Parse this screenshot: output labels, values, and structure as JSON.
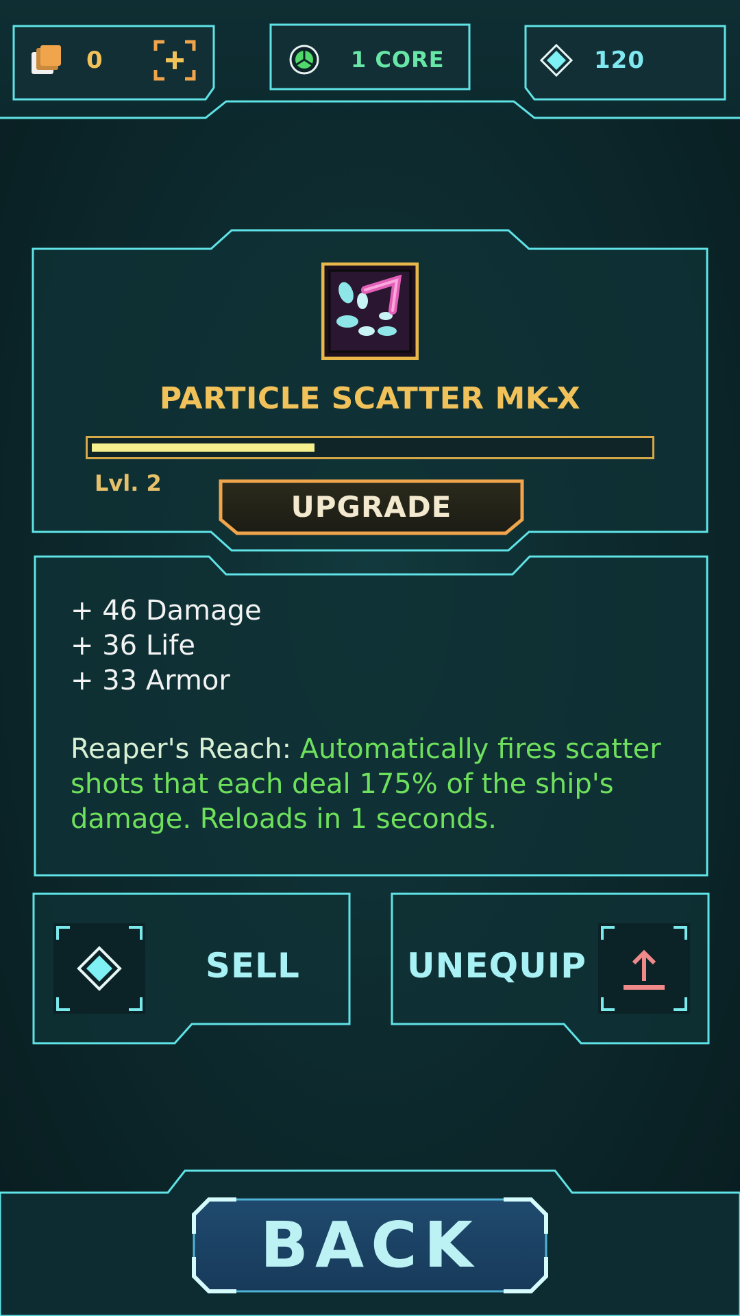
{
  "resources": {
    "cards_count": "0",
    "cores_label": "1 CORE",
    "gems_count": "120"
  },
  "item": {
    "name": "PARTICLE SCATTER MK-X",
    "level_label": "Lvl. 2",
    "xp_progress": 0.4,
    "upgrade_label": "UPGRADE"
  },
  "stats": {
    "lines": [
      "+ 46 Damage",
      "+ 36 Life",
      "+ 33 Armor"
    ],
    "ability_name": "Reaper's Reach:",
    "ability_text": "Automatically fires scatter shots that each deal 175% of the ship's damage. Reloads in 1 seconds."
  },
  "actions": {
    "sell_label": "SELL",
    "unequip_label": "UNEQUIP",
    "back_label": "BACK"
  },
  "colors": {
    "frame": "#5fe3e6",
    "gold": "#f2c25a",
    "ability_green": "#6fe05c",
    "gem": "#7ff0f4",
    "unequip_arrow": "#f08a8a"
  }
}
